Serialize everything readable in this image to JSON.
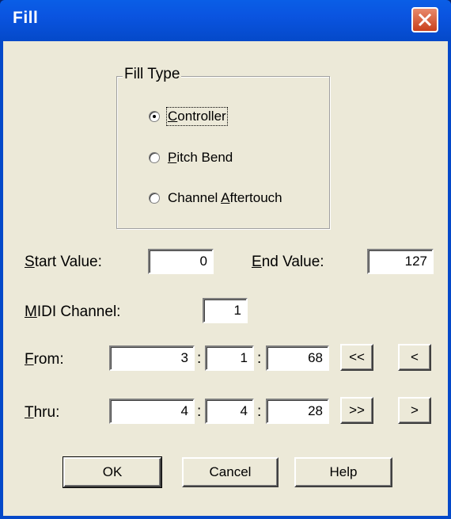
{
  "window": {
    "title": "Fill"
  },
  "fill_type": {
    "legend": "Fill Type",
    "options": [
      {
        "pre": "",
        "acc": "C",
        "post": "ontroller",
        "checked": true
      },
      {
        "pre": "",
        "acc": "P",
        "post": "itch Bend",
        "checked": false
      },
      {
        "pre": "Channel ",
        "acc": "A",
        "post": "ftertouch",
        "checked": false
      }
    ]
  },
  "start_value": {
    "acc": "S",
    "post": "tart Value:",
    "value": "0"
  },
  "end_value": {
    "acc": "E",
    "post": "nd Value:",
    "value": "127"
  },
  "midi_channel": {
    "acc": "M",
    "post": "IDI Channel:",
    "value": "1"
  },
  "from": {
    "acc": "F",
    "post": "rom:",
    "bar": "3",
    "beat": "1",
    "tick": "68",
    "btn_first": "<<",
    "btn_prev": "<"
  },
  "thru": {
    "acc": "T",
    "post": "hru:",
    "bar": "4",
    "beat": "4",
    "tick": "28",
    "btn_last": ">>",
    "btn_next": ">"
  },
  "separator": ":",
  "buttons": {
    "ok": "OK",
    "cancel": "Cancel",
    "help": "Help"
  }
}
